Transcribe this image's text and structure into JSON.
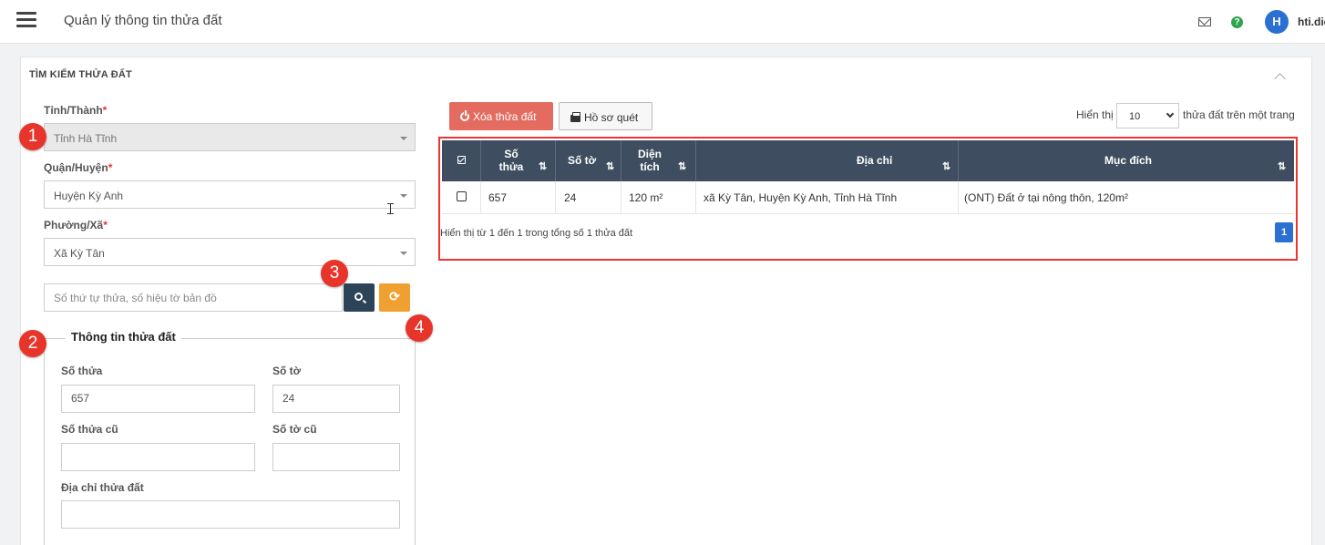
{
  "app": {
    "title": "Quản lý thông tin thửa đất"
  },
  "user": {
    "initial": "H",
    "name": "hti.diep"
  },
  "search_panel": {
    "title": "TÌM KIẾM THỬA ĐẤT",
    "province": {
      "label": "Tỉnh/Thành",
      "required": "*",
      "value": "Tỉnh Hà Tĩnh"
    },
    "district": {
      "label": "Quận/Huyện",
      "required": "*",
      "value": "Huyện Kỳ Anh"
    },
    "ward": {
      "label": "Phường/Xã",
      "required": "*",
      "value": "Xã Kỳ Tân"
    },
    "search": {
      "placeholder": "Số thứ tự thửa, số hiệu tờ bản đồ"
    }
  },
  "parcel_info": {
    "title": "Thông tin thửa đất",
    "parcel_no": {
      "label": "Số thửa",
      "value": "657"
    },
    "sheet_no": {
      "label": "Số tờ",
      "value": "24"
    },
    "old_parcel_no": {
      "label": "Số thửa cũ",
      "value": ""
    },
    "old_sheet_no": {
      "label": "Số tờ cũ",
      "value": ""
    },
    "address": {
      "label": "Địa chỉ thửa đất",
      "value": ""
    }
  },
  "annotations": [
    "1",
    "2",
    "3",
    "4"
  ],
  "toolbar": {
    "delete_label": "Xóa thửa đất",
    "scan_label": "Hồ sơ quét",
    "show_label": "Hiển thị",
    "page_size": "10",
    "per_page_label": "thửa đất trên một trang"
  },
  "table": {
    "headers": {
      "parcel_no": [
        "Số",
        "thửa"
      ],
      "sheet_no": "Số tờ",
      "area": [
        "Diện",
        "tích"
      ],
      "address": "Địa chỉ",
      "purpose": "Mục đích"
    },
    "rows": [
      {
        "parcel_no": "657",
        "sheet_no": "24",
        "area": "120 m²",
        "address": "xã Kỳ Tân, Huyện Kỳ Anh, Tỉnh Hà Tĩnh",
        "purpose": "(ONT) Đất ở tại nông thôn, 120m²"
      }
    ],
    "footer_info": "Hiển thị từ 1 đến 1 trong tổng số 1 thửa đất",
    "current_page": "1"
  },
  "colors": {
    "table_header": "#3e4e60",
    "delete_button": "#e36b5f",
    "search_button": "#2d4458",
    "refresh_button": "#f0a030",
    "annotation_badge": "#e8352b",
    "highlight_border": "#e33333",
    "pagination_active": "#2a6fd1"
  }
}
